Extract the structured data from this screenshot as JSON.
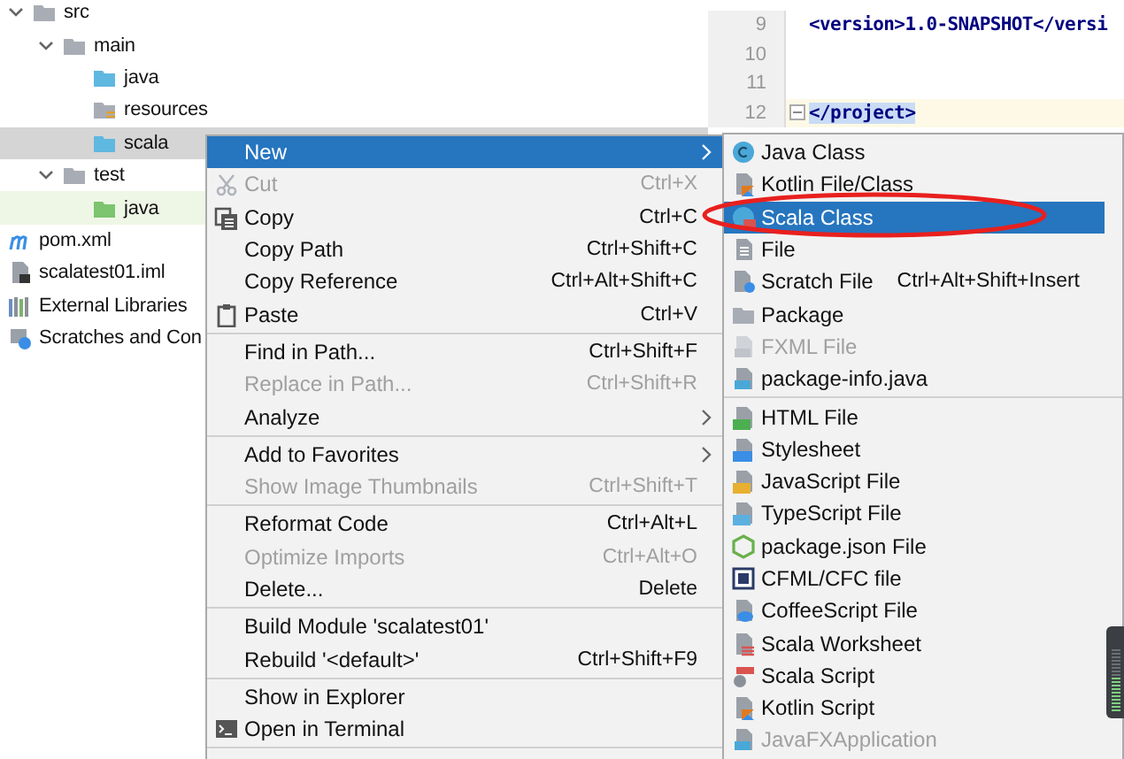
{
  "project_tree": [
    {
      "label": "src",
      "kind": "folder",
      "expanded": true,
      "selected": false,
      "children": [
        {
          "label": "main",
          "kind": "folder",
          "expanded": true,
          "selected": false,
          "children": [
            {
              "label": "java",
              "kind": "source",
              "selected": false
            },
            {
              "label": "resources",
              "kind": "resources",
              "selected": false
            },
            {
              "label": "scala",
              "kind": "source",
              "selected": true
            }
          ]
        },
        {
          "label": "test",
          "kind": "folder",
          "expanded": true,
          "selected": false,
          "children": [
            {
              "label": "java",
              "kind": "test-source",
              "selected": false
            }
          ]
        }
      ]
    },
    {
      "label": "pom.xml",
      "kind": "maven",
      "selected": false
    },
    {
      "label": "scalatest01.iml",
      "kind": "module",
      "selected": false
    },
    {
      "label": "External Libraries",
      "kind": "libraries",
      "selected": false
    },
    {
      "label": "Scratches and Con",
      "kind": "scratches",
      "selected": false
    }
  ],
  "editor": {
    "lines": [
      {
        "number": "9",
        "code": "<version>1.0-SNAPSHOT</versi",
        "current": false
      },
      {
        "number": "10",
        "current": false
      },
      {
        "number": "11",
        "current": false
      },
      {
        "number": "12",
        "code": "</project>",
        "current": true
      }
    ]
  },
  "context_menu": [
    {
      "kind": "item",
      "label": "New",
      "submenu": true,
      "selected": true,
      "disabled": false
    },
    {
      "kind": "item",
      "label": "Cut",
      "shortcut": "Ctrl+X",
      "selected": false,
      "disabled": true
    },
    {
      "kind": "item",
      "label": "Copy",
      "shortcut": "Ctrl+C",
      "selected": false,
      "disabled": false
    },
    {
      "kind": "item",
      "label": "Copy Path",
      "shortcut": "Ctrl+Shift+C",
      "selected": false,
      "disabled": false
    },
    {
      "kind": "item",
      "label": "Copy Reference",
      "shortcut": "Ctrl+Alt+Shift+C",
      "selected": false,
      "disabled": false
    },
    {
      "kind": "item",
      "label": "Paste",
      "shortcut": "Ctrl+V",
      "selected": false,
      "disabled": false
    },
    {
      "kind": "separator"
    },
    {
      "kind": "item",
      "label": "Find in Path...",
      "shortcut": "Ctrl+Shift+F",
      "selected": false,
      "disabled": false
    },
    {
      "kind": "item",
      "label": "Replace in Path...",
      "shortcut": "Ctrl+Shift+R",
      "selected": false,
      "disabled": true
    },
    {
      "kind": "item",
      "label": "Analyze",
      "submenu": true,
      "selected": false,
      "disabled": false
    },
    {
      "kind": "separator"
    },
    {
      "kind": "item",
      "label": "Add to Favorites",
      "submenu": true,
      "selected": false,
      "disabled": false
    },
    {
      "kind": "item",
      "label": "Show Image Thumbnails",
      "shortcut": "Ctrl+Shift+T",
      "selected": false,
      "disabled": true
    },
    {
      "kind": "separator"
    },
    {
      "kind": "item",
      "label": "Reformat Code",
      "shortcut": "Ctrl+Alt+L",
      "selected": false,
      "disabled": false
    },
    {
      "kind": "item",
      "label": "Optimize Imports",
      "shortcut": "Ctrl+Alt+O",
      "selected": false,
      "disabled": true
    },
    {
      "kind": "item",
      "label": "Delete...",
      "shortcut": "Delete",
      "selected": false,
      "disabled": false
    },
    {
      "kind": "separator"
    },
    {
      "kind": "item",
      "label": "Build Module 'scalatest01'",
      "selected": false,
      "disabled": false
    },
    {
      "kind": "item",
      "label": "Rebuild '<default>'",
      "shortcut": "Ctrl+Shift+F9",
      "selected": false,
      "disabled": false
    },
    {
      "kind": "separator"
    },
    {
      "kind": "item",
      "label": "Show in Explorer",
      "selected": false,
      "disabled": false
    },
    {
      "kind": "item",
      "label": "Open in Terminal",
      "selected": false,
      "disabled": false
    },
    {
      "kind": "separator"
    }
  ],
  "new_submenu": [
    {
      "kind": "item",
      "label": "Java Class",
      "selected": false,
      "disabled": false
    },
    {
      "kind": "item",
      "label": "Kotlin File/Class",
      "selected": false,
      "disabled": false
    },
    {
      "kind": "item",
      "label": "Scala Class",
      "selected": true,
      "disabled": false
    },
    {
      "kind": "item",
      "label": "File",
      "selected": false,
      "disabled": false
    },
    {
      "kind": "item",
      "label": "Scratch File",
      "shortcut": "Ctrl+Alt+Shift+Insert",
      "selected": false,
      "disabled": false
    },
    {
      "kind": "item",
      "label": "Package",
      "selected": false,
      "disabled": false
    },
    {
      "kind": "item",
      "label": "FXML File",
      "selected": false,
      "disabled": true
    },
    {
      "kind": "item",
      "label": "package-info.java",
      "selected": false,
      "disabled": false
    },
    {
      "kind": "separator"
    },
    {
      "kind": "item",
      "label": "HTML File",
      "selected": false,
      "disabled": false
    },
    {
      "kind": "item",
      "label": "Stylesheet",
      "selected": false,
      "disabled": false
    },
    {
      "kind": "item",
      "label": "JavaScript File",
      "selected": false,
      "disabled": false
    },
    {
      "kind": "item",
      "label": "TypeScript File",
      "selected": false,
      "disabled": false
    },
    {
      "kind": "item",
      "label": "package.json File",
      "selected": false,
      "disabled": false
    },
    {
      "kind": "item",
      "label": "CFML/CFC file",
      "selected": false,
      "disabled": false
    },
    {
      "kind": "item",
      "label": "CoffeeScript File",
      "selected": false,
      "disabled": false
    },
    {
      "kind": "item",
      "label": "Scala Worksheet",
      "selected": false,
      "disabled": false
    },
    {
      "kind": "item",
      "label": "Scala Script",
      "selected": false,
      "disabled": false
    },
    {
      "kind": "item",
      "label": "Kotlin Script",
      "selected": false,
      "disabled": false
    },
    {
      "kind": "item",
      "label": "JavaFXApplication",
      "selected": false,
      "disabled": true
    }
  ]
}
